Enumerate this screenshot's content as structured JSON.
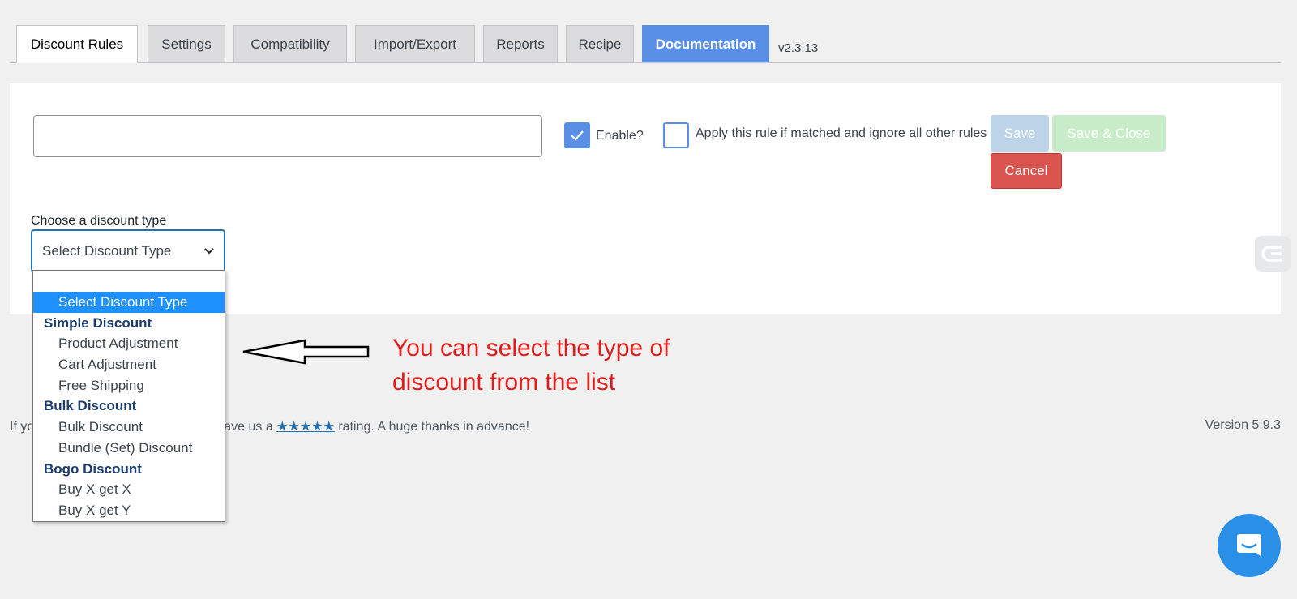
{
  "tabs": [
    {
      "label": "Discount Rules",
      "active": true
    },
    {
      "label": "Settings",
      "active": false
    },
    {
      "label": "Compatibility",
      "active": false
    },
    {
      "label": "Import/Export",
      "active": false
    },
    {
      "label": "Reports",
      "active": false
    },
    {
      "label": "Recipe",
      "active": false
    },
    {
      "label": "Documentation",
      "active": false
    }
  ],
  "plugin_version": "v2.3.13",
  "rule_form": {
    "title_value": "",
    "enable_label": "Enable?",
    "enable_checked": true,
    "exclusive_label": "Apply this rule if matched and ignore all other rules",
    "exclusive_checked": false,
    "save_label": "Save",
    "save_close_label": "Save & Close",
    "cancel_label": "Cancel",
    "discount_type_label": "Choose a discount type",
    "discount_type_selected": "Select Discount Type"
  },
  "dropdown": {
    "items": [
      {
        "label": "Select Discount Type",
        "kind": "option",
        "selected": true
      },
      {
        "label": "Simple Discount",
        "kind": "group"
      },
      {
        "label": "Product Adjustment",
        "kind": "option"
      },
      {
        "label": "Cart Adjustment",
        "kind": "option"
      },
      {
        "label": "Free Shipping",
        "kind": "option"
      },
      {
        "label": "Bulk Discount",
        "kind": "group"
      },
      {
        "label": "Bulk Discount",
        "kind": "option"
      },
      {
        "label": "Bundle (Set) Discount",
        "kind": "option"
      },
      {
        "label": "Bogo Discount",
        "kind": "group"
      },
      {
        "label": "Buy X get X",
        "kind": "option"
      },
      {
        "label": "Buy X get Y",
        "kind": "option"
      }
    ]
  },
  "annotation": {
    "text": "You can select the type of discount from the list"
  },
  "footer": {
    "left_visible_start": "If yo",
    "left_visible_end": "ave us a",
    "stars": "★★★★★",
    "after_stars": "rating. A huge thanks in advance!",
    "version": "Version 5.9.3"
  },
  "colors": {
    "accent": "#5a8fe6",
    "cancel": "#d9534f",
    "annotation": "#e21b1b",
    "chat": "#2a8fe6"
  },
  "icons": {
    "check": "check-icon",
    "chevron": "chevron-down-icon",
    "side_widget": "widget-logo-icon",
    "arrow": "left-arrow-icon",
    "chat": "chat-icon"
  }
}
